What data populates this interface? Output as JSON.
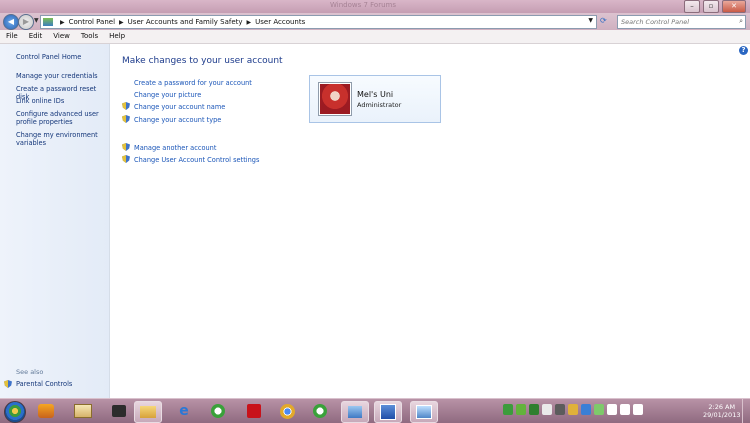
{
  "window": {
    "title": "Windows 7 Forums"
  },
  "address": {
    "breadcrumbs": [
      "Control Panel",
      "User Accounts and Family Safety",
      "User Accounts"
    ],
    "search_placeholder": "Search Control Panel"
  },
  "menu": [
    "File",
    "Edit",
    "View",
    "Tools",
    "Help"
  ],
  "sidebar": {
    "home": "Control Panel Home",
    "tasks": [
      "Manage your credentials",
      "Create a password reset disk",
      "Link online IDs",
      "Configure advanced user profile properties",
      "Change my environment variables"
    ],
    "see_also": "See also",
    "parental": "Parental Controls"
  },
  "main": {
    "heading": "Make changes to your user account",
    "actions": [
      "Create a password for your account",
      "Change your picture",
      "Change your account name",
      "Change your account type"
    ],
    "other_actions": [
      "Manage another account",
      "Change User Account Control settings"
    ],
    "user": {
      "name": "Mel's Uni",
      "role": "Administrator"
    }
  },
  "taskbar": {
    "time": "2:26 AM",
    "date": "29/01/2013"
  },
  "colors": {
    "link": "#1b56b8",
    "heading": "#1e3c8c",
    "accent_frame": "#c59db3"
  }
}
